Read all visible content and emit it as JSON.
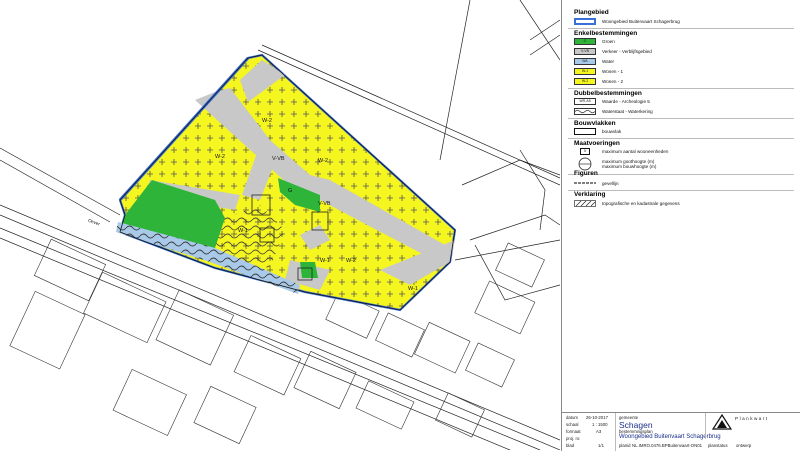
{
  "legend": {
    "plangebied_title": "Plangebied",
    "plangebied_label": "Woongebied Buitenvaart Schagerbrug",
    "enkel_title": "Enkelbestemmingen",
    "enkel": [
      {
        "code": "G",
        "label": "Groen",
        "color": "#2fb43a"
      },
      {
        "code": "V-VB",
        "label": "Verkeer - Verblijfsgebied",
        "color": "#c8c8c8"
      },
      {
        "code": "WA",
        "label": "Water",
        "color": "#a9c9e8"
      },
      {
        "code": "W-1",
        "label": "Wonen - 1",
        "color": "#f5f51f"
      },
      {
        "code": "W-2",
        "label": "Wonen - 2",
        "color": "#f5f51f"
      }
    ],
    "dubbel_title": "Dubbelbestemmingen",
    "dubbel": [
      {
        "code": "WR-A5",
        "label": "Waarde - Archeologie 5"
      },
      {
        "code": "WS",
        "label": "Waterstaat - Waterkering"
      }
    ],
    "bouw_title": "Bouwvlakken",
    "bouw_label": "bouwvlak",
    "maat_title": "Maatvoeringen",
    "maat_units_value": "5",
    "maat_units": "maximum aantal wooneenheden",
    "maat_goot": "maximum goothoogte (m)",
    "maat_bouw": "maximum bouwhoogte (m)",
    "fig_title": "Figuren",
    "fig_label": "gevellijn",
    "verk_title": "Verklaring",
    "verk_label": "topografische en kadastrale gegevens"
  },
  "titleblock": {
    "datum_label": "datum",
    "datum": "26-10-2017",
    "schaal_label": "schaal",
    "schaal": "1 : 1500",
    "formaat_label": "formaat",
    "formaat": "A3",
    "proj_label": "proj. nr.",
    "blad_label": "blad",
    "blad": "1/1",
    "gemeente_label": "gemeente",
    "gemeente": "Schagen",
    "sub_label": "bestemmingsplan",
    "plan_name": "Woongebied Buitenvaart Schagerbrug",
    "planid_label": "planid",
    "planid": "NL.IMRO.0476.BPBuitenvaart-ON01",
    "planstatus_label": "planstatus",
    "planstatus": "ontwerp",
    "logo_text": "Plankwart",
    "logo_color": "#1a1a1a"
  },
  "map": {
    "labels": {
      "w2_north": "W-2",
      "w2_north_b": "W-2",
      "v_vb": "V-VB",
      "w2_west": "W-2",
      "w1_mid": "W-1",
      "w2_south": "W-2",
      "w1_east": "W-1",
      "g_small": "G",
      "v_vb_2": "V-VB",
      "w1_corner": "W-1",
      "street_left": "Oever"
    },
    "colors": {
      "yellow": "#f5f51f",
      "green": "#2fb43a",
      "grey": "#c8c8c8",
      "water": "#a9c9e8",
      "plan_border": "#3a6fd8"
    }
  }
}
